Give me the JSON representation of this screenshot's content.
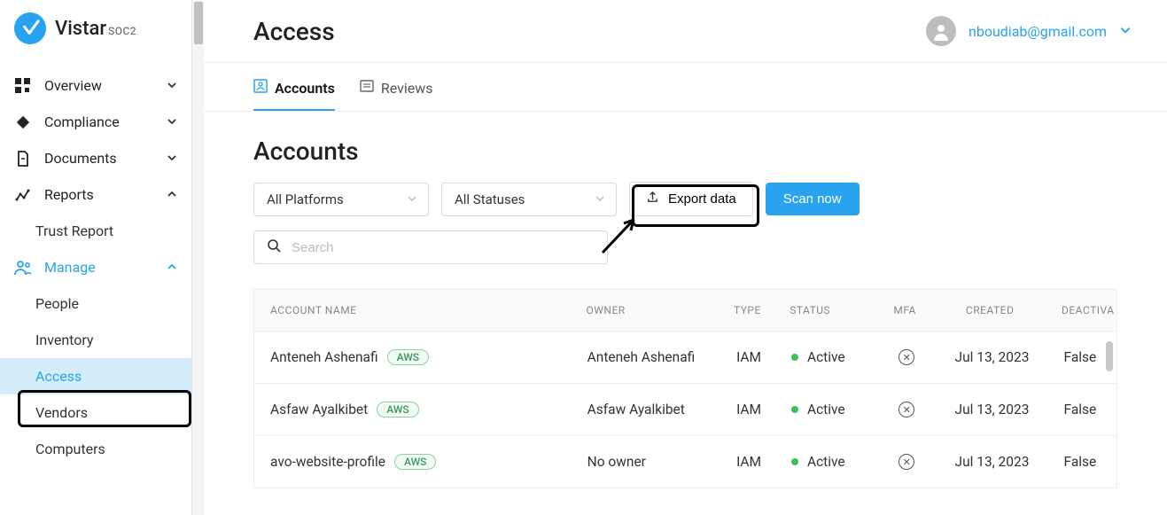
{
  "brand": {
    "name": "Vistar",
    "suffix": "SOC2"
  },
  "sidebar": {
    "items": [
      {
        "label": "Overview",
        "icon": "dashboard-icon",
        "hasChildren": true,
        "expanded": false
      },
      {
        "label": "Compliance",
        "icon": "diamond-icon",
        "hasChildren": true,
        "expanded": false
      },
      {
        "label": "Documents",
        "icon": "document-icon",
        "hasChildren": true,
        "expanded": false
      },
      {
        "label": "Reports",
        "icon": "reports-icon",
        "hasChildren": true,
        "expanded": true
      },
      {
        "label": "Manage",
        "icon": "people-icon",
        "hasChildren": true,
        "expanded": true,
        "active": true
      }
    ],
    "reports_children": [
      {
        "label": "Trust Report"
      }
    ],
    "manage_children": [
      {
        "label": "People"
      },
      {
        "label": "Inventory"
      },
      {
        "label": "Access",
        "selected": true
      },
      {
        "label": "Vendors"
      },
      {
        "label": "Computers"
      }
    ]
  },
  "header": {
    "title": "Access",
    "user_email": "nboudiab@gmail.com"
  },
  "tabs": [
    {
      "label": "Accounts",
      "active": true
    },
    {
      "label": "Reviews",
      "active": false
    }
  ],
  "accounts": {
    "title": "Accounts",
    "filter_platform": "All Platforms",
    "filter_status": "All Statuses",
    "export_label": "Export data",
    "scan_label": "Scan now",
    "search_placeholder": "Search",
    "columns": {
      "name": "ACCOUNT NAME",
      "owner": "OWNER",
      "type": "TYPE",
      "status": "STATUS",
      "mfa": "MFA",
      "created": "CREATED",
      "deactivated": "DEACTIVA"
    },
    "rows": [
      {
        "name": "Anteneh Ashenafi",
        "platform": "AWS",
        "owner": "Anteneh Ashenafi",
        "type": "IAM",
        "status": "Active",
        "mfa": false,
        "created": "Jul 13, 2023",
        "deactivated": "False"
      },
      {
        "name": "Asfaw Ayalkibet",
        "platform": "AWS",
        "owner": "Asfaw Ayalkibet",
        "type": "IAM",
        "status": "Active",
        "mfa": false,
        "created": "Jul 13, 2023",
        "deactivated": "False"
      },
      {
        "name": "avo-website-profile",
        "platform": "AWS",
        "owner": "No owner",
        "type": "IAM",
        "status": "Active",
        "mfa": false,
        "created": "Jul 13, 2023",
        "deactivated": "False"
      }
    ]
  }
}
